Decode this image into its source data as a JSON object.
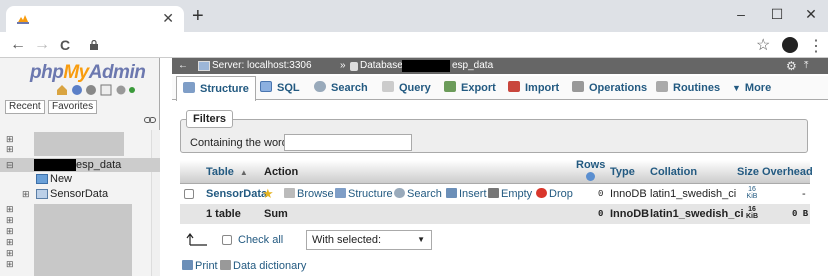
{
  "browser": {
    "tab_close": "✕",
    "new_tab": "+",
    "win_min": "–",
    "win_max": "☐",
    "win_close": "✕",
    "back": "←",
    "forward": "→",
    "reload": "C",
    "star": "☆",
    "menu": "⋮"
  },
  "sidebar": {
    "logo_php": "php",
    "logo_my": "My",
    "logo_admin": "Admin",
    "recent": "Recent",
    "favorites": "Favorites",
    "db_suffix": "esp_data",
    "new_label": "New",
    "table_label": "SensorData"
  },
  "header": {
    "server": "Server: localhost:3306",
    "sep": "»",
    "database_prefix": "Database:",
    "database_suffix": "esp_data"
  },
  "tabs": [
    {
      "label": "Structure"
    },
    {
      "label": "SQL"
    },
    {
      "label": "Search"
    },
    {
      "label": "Query"
    },
    {
      "label": "Export"
    },
    {
      "label": "Import"
    },
    {
      "label": "Operations"
    },
    {
      "label": "Routines"
    },
    {
      "label": "More"
    }
  ],
  "filters": {
    "legend": "Filters",
    "label": "Containing the word:",
    "value": ""
  },
  "table": {
    "headers": {
      "table": "Table",
      "action": "Action",
      "rows_line1": "Rows",
      "type": "Type",
      "collation": "Collation",
      "size": "Size",
      "overhead": "Overhead"
    },
    "row": {
      "name": "SensorData",
      "browse": "Browse",
      "structure": "Structure",
      "search": "Search",
      "insert": "Insert",
      "empty": "Empty",
      "drop": "Drop",
      "rows": "0",
      "type": "InnoDB",
      "collation": "latin1_swedish_ci",
      "size_num": "16",
      "size_unit": "KiB",
      "overhead": "-"
    },
    "summary": {
      "count": "1 table",
      "sum": "Sum",
      "rows": "0",
      "type": "InnoDB",
      "collation": "latin1_swedish_ci",
      "size_num": "16",
      "size_unit": "KiB",
      "overhead": "0 B"
    }
  },
  "bottom": {
    "check_all": "Check all",
    "with_selected": "With selected:",
    "print": "Print",
    "data_dictionary": "Data dictionary"
  }
}
